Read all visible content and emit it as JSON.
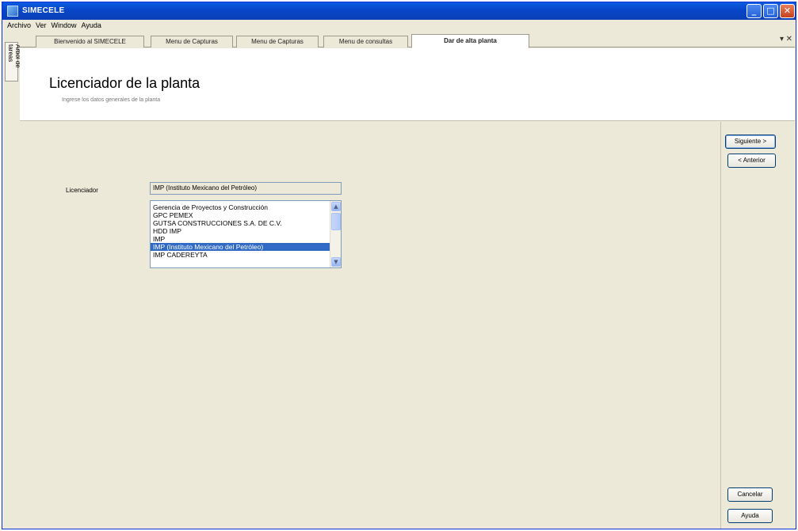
{
  "window": {
    "title": "SIMECELE"
  },
  "menu": [
    "Archivo",
    "Ver",
    "Window",
    "Ayuda"
  ],
  "side_panel": {
    "label": "Árbol de tareas"
  },
  "tabs": [
    {
      "label": "Bienvenido al SIMECELE",
      "active": false
    },
    {
      "label": "Menu de Capturas",
      "active": false
    },
    {
      "label": "Menu de Capturas",
      "active": false
    },
    {
      "label": "Menu de consultas",
      "active": false
    },
    {
      "label": "Dar de alta planta",
      "active": true
    }
  ],
  "header": {
    "title": "Licenciador de la planta",
    "subtitle": "Ingrese los datos generales de la planta"
  },
  "form": {
    "licenciador_label": "Licenciador",
    "licenciador_value": "IMP (Instituto Mexicano del Petróleo)",
    "options": [
      "Gerencia de Proyectos y Construcción",
      "GPC PEMEX",
      "GUTSA CONSTRUCCIONES S.A. DE C.V.",
      "HDD IMP",
      "IMP",
      "IMP (Instituto Mexicano del Petróleo)",
      "IMP CADEREYTA"
    ],
    "selected_option": "IMP (Instituto Mexicano del Petróleo)"
  },
  "buttons": {
    "next": "Siguiente >",
    "prev": "< Anterior",
    "cancel": "Cancelar",
    "help": "Ayuda"
  },
  "colors": {
    "titlebar": "#0846c8",
    "selection": "#316ac5",
    "panel": "#ece9d8"
  },
  "icons": {
    "minimize": "minimize-icon",
    "maximize": "maximize-icon",
    "close": "close-icon"
  }
}
